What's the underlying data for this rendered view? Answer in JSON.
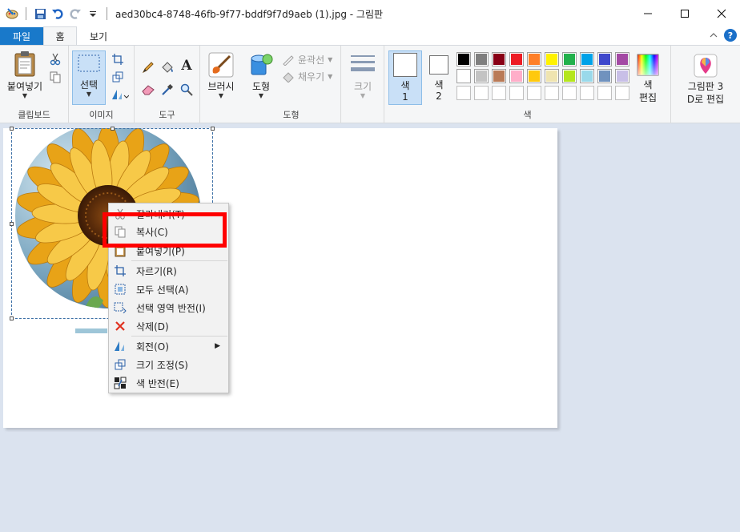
{
  "window": {
    "title": "aed30bc4-8748-46fb-9f77-bddf9f7d9aeb (1).jpg - 그림판"
  },
  "tabs": {
    "file": "파일",
    "home": "홈",
    "view": "보기"
  },
  "ribbon": {
    "clipboard": {
      "paste": "붙여넣기",
      "group": "클립보드"
    },
    "image": {
      "select": "선택",
      "group": "이미지"
    },
    "tools": {
      "group": "도구",
      "text_icon": "A"
    },
    "brushes": {
      "label": "브러시"
    },
    "shapes": {
      "shape": "도형",
      "outline": "윤곽선",
      "fill": "채우기",
      "group": "도형"
    },
    "size": {
      "label": "크기"
    },
    "colors": {
      "color1": "색",
      "color1_num": "1",
      "color2": "색",
      "color2_num": "2",
      "edit_colors_1": "색",
      "edit_colors_2": "편집",
      "group": "색",
      "palette_row1": [
        "#000000",
        "#7f7f7f",
        "#880015",
        "#ed1c24",
        "#ff7f27",
        "#fff200",
        "#22b14c",
        "#00a2e8",
        "#3f48cc",
        "#a349a4"
      ],
      "palette_row2": [
        "#ffffff",
        "#c3c3c3",
        "#b97a57",
        "#ffaec9",
        "#ffc90e",
        "#efe4b0",
        "#b5e61d",
        "#99d9ea",
        "#7092be",
        "#c8bfe7"
      ],
      "palette_row3": [
        "#ffffff",
        "#ffffff",
        "#ffffff",
        "#ffffff",
        "#ffffff",
        "#ffffff",
        "#ffffff",
        "#ffffff",
        "#ffffff",
        "#ffffff"
      ]
    },
    "paint3d": {
      "line1": "그림판 3",
      "line2": "D로 편집"
    }
  },
  "context_menu": {
    "items": [
      {
        "label": "잘라내기(T)",
        "icon": "scissors-icon"
      },
      {
        "label": "복사(C)",
        "icon": "copy-icon"
      },
      {
        "label": "붙여넣기(P)",
        "icon": "paste-icon"
      },
      {
        "label": "자르기(R)",
        "icon": "crop-icon"
      },
      {
        "label": "모두 선택(A)",
        "icon": "select-all-icon"
      },
      {
        "label": "선택 영역 반전(I)",
        "icon": "invert-selection-icon"
      },
      {
        "label": "삭제(D)",
        "icon": "delete-icon"
      },
      {
        "label": "회전(O)",
        "icon": "rotate-icon"
      },
      {
        "label": "크기 조정(S)",
        "icon": "resize-icon"
      },
      {
        "label": "색 반전(E)",
        "icon": "invert-color-icon"
      }
    ],
    "submenu_arrow": "▶"
  }
}
